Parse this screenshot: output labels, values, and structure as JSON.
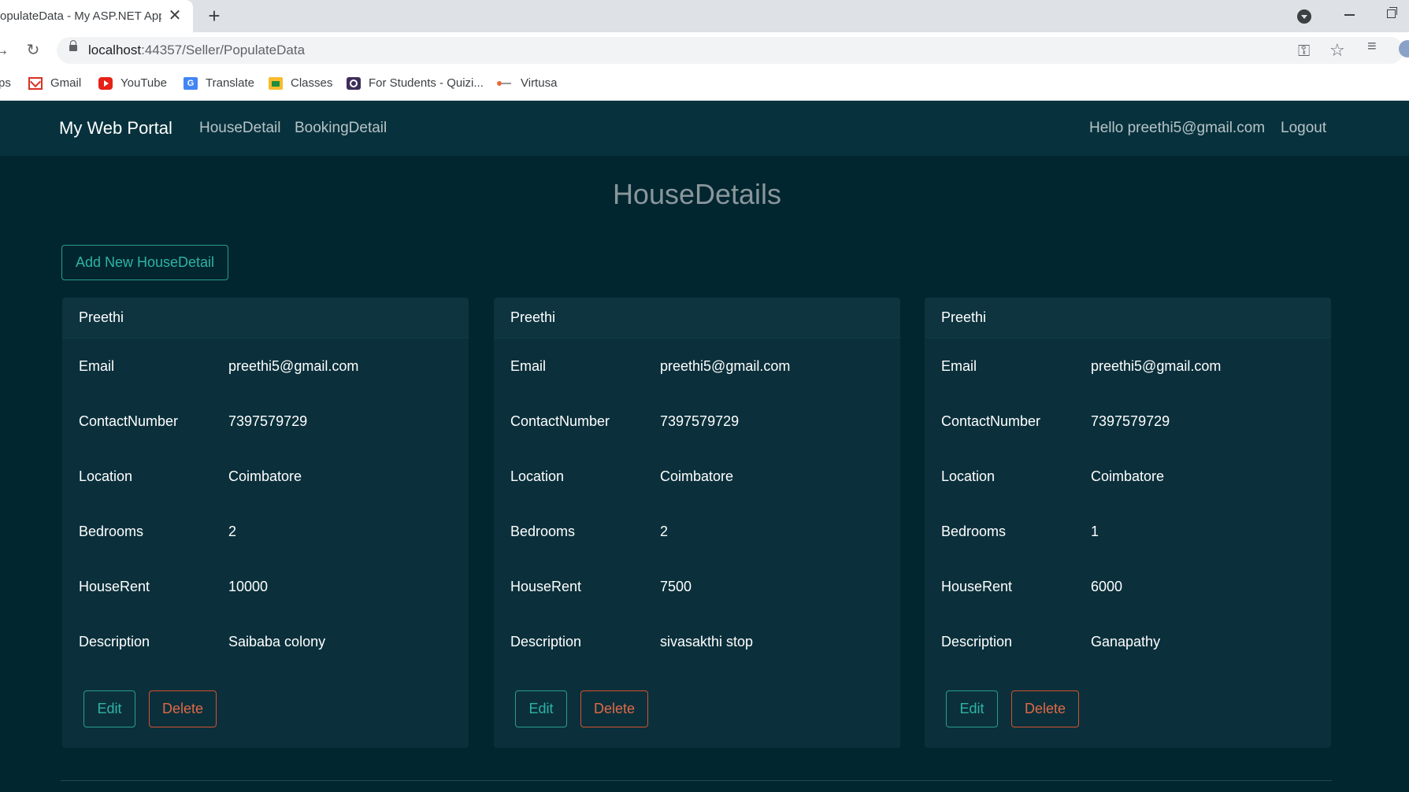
{
  "browser": {
    "tab_title": "opulateData - My ASP.NET Appl",
    "tab_close": "✕",
    "new_tab": "+",
    "url_host": "localhost",
    "url_path": ":44357/Seller/PopulateData",
    "bookmarks": [
      {
        "label": "ps",
        "icon": "apps-icon"
      },
      {
        "label": "Gmail",
        "icon": "gmail-icon"
      },
      {
        "label": "YouTube",
        "icon": "youtube-icon"
      },
      {
        "label": "Translate",
        "icon": "translate-icon"
      },
      {
        "label": "Classes",
        "icon": "classes-icon"
      },
      {
        "label": "For Students - Quizi...",
        "icon": "quizizz-icon"
      },
      {
        "label": "Virtusa",
        "icon": "virtusa-icon"
      }
    ]
  },
  "site": {
    "brand": "My Web Portal",
    "nav": [
      "HouseDetail",
      "BookingDetail"
    ],
    "greeting": "Hello preethi5@gmail.com",
    "logout": "Logout",
    "page_title": "HouseDetails",
    "add_button": "Add New HouseDetail"
  },
  "labels": {
    "email": "Email",
    "contact": "ContactNumber",
    "location": "Location",
    "bedrooms": "Bedrooms",
    "rent": "HouseRent",
    "description": "Description",
    "edit": "Edit",
    "delete": "Delete"
  },
  "houses": [
    {
      "name": "Preethi",
      "email": "preethi5@gmail.com",
      "contact": "7397579729",
      "location": "Coimbatore",
      "bedrooms": "2",
      "rent": "10000",
      "description": "Saibaba colony"
    },
    {
      "name": "Preethi",
      "email": "preethi5@gmail.com",
      "contact": "7397579729",
      "location": "Coimbatore",
      "bedrooms": "2",
      "rent": "7500",
      "description": "sivasakthi stop"
    },
    {
      "name": "Preethi",
      "email": "preethi5@gmail.com",
      "contact": "7397579729",
      "location": "Coimbatore",
      "bedrooms": "1",
      "rent": "6000",
      "description": "Ganapathy"
    }
  ],
  "colors": {
    "page_bg": "#01262f",
    "navbar_bg": "#07323d",
    "card_bg": "#0b303b",
    "accent_teal": "#2fb3a5",
    "accent_orange": "#e06a45"
  }
}
